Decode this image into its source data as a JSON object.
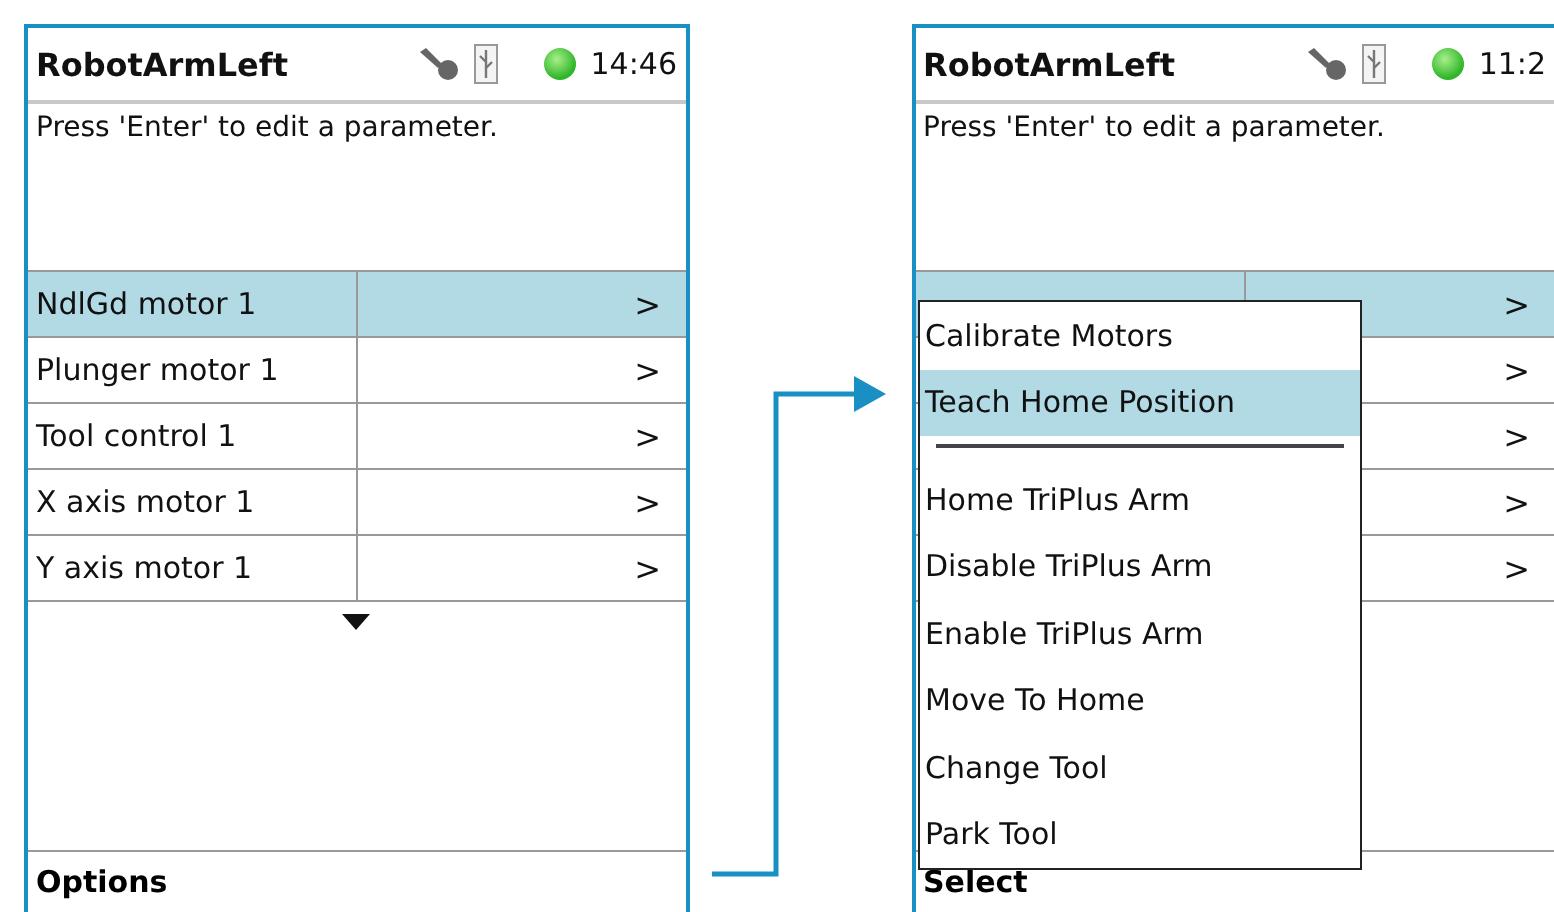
{
  "screens": [
    {
      "title": "RobotArmLeft",
      "time": "14:46",
      "message": "Press 'Enter' to edit a parameter.",
      "rows": [
        {
          "label": "NdlGd motor 1",
          "chevron": ">",
          "selected": true
        },
        {
          "label": "Plunger motor 1",
          "chevron": ">",
          "selected": false
        },
        {
          "label": "Tool control 1",
          "chevron": ">",
          "selected": false
        },
        {
          "label": "X axis motor 1",
          "chevron": ">",
          "selected": false
        },
        {
          "label": "Y axis motor 1",
          "chevron": ">",
          "selected": false
        }
      ],
      "more_below": true,
      "footer": "Options"
    },
    {
      "title": "RobotArmLeft",
      "time": "11:2",
      "message": "Press 'Enter' to edit a parameter.",
      "rows": [
        {
          "chevron": ">",
          "selected": true
        },
        {
          "chevron": ">",
          "selected": false
        },
        {
          "chevron": ">",
          "selected": false
        },
        {
          "chevron": ">",
          "selected": false
        },
        {
          "chevron": ">",
          "selected": false
        }
      ],
      "footer": "Select",
      "menu": {
        "items": [
          {
            "kind": "item",
            "label": "Calibrate Motors",
            "selected": false
          },
          {
            "kind": "item",
            "label": "Teach Home Position",
            "selected": true
          },
          {
            "kind": "separator"
          },
          {
            "kind": "item",
            "label": "Home TriPlus Arm",
            "selected": false
          },
          {
            "kind": "item",
            "label": "Disable TriPlus Arm",
            "selected": false
          },
          {
            "kind": "item",
            "label": "Enable TriPlus Arm",
            "selected": false
          },
          {
            "kind": "item",
            "label": "Move To Home",
            "selected": false
          },
          {
            "kind": "item",
            "label": "Change Tool",
            "selected": false
          },
          {
            "kind": "item",
            "label": "Park Tool",
            "selected": false
          }
        ]
      }
    }
  ]
}
